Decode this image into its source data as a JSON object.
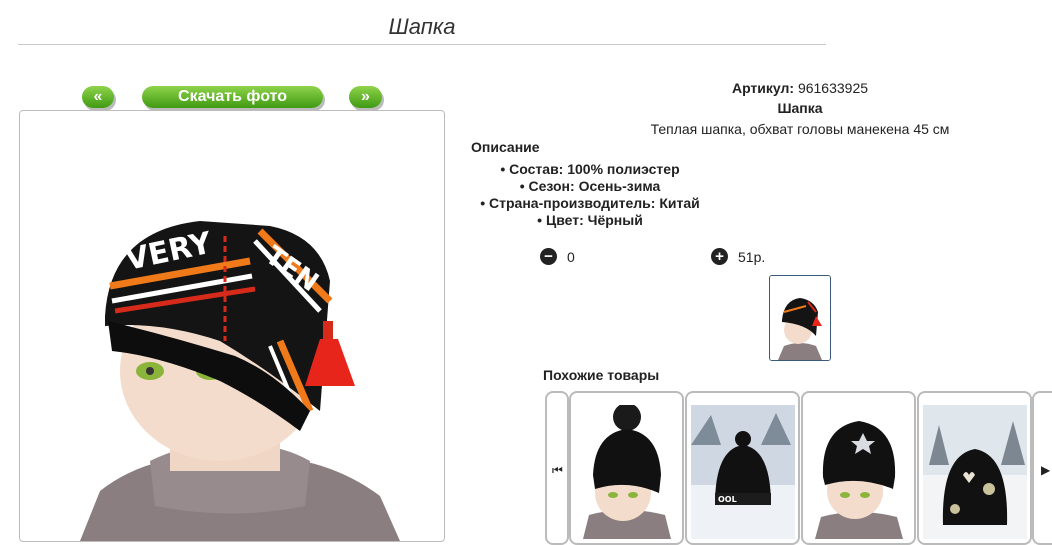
{
  "page": {
    "title": "Шапка"
  },
  "nav": {
    "prev_label": "«",
    "download_label": "Скачать фото",
    "next_label": "»"
  },
  "product": {
    "article_label": "Артикул:",
    "article_value": "961633925",
    "name": "Шапка",
    "short_description": "Теплая шапка, обхват головы манекена 45 см"
  },
  "description": {
    "heading": "Описание",
    "items": [
      "Состав: 100% полиэстер",
      "Сезон: Осень-зима",
      "Страна-производитель: Китай",
      "Цвет: Чёрный"
    ]
  },
  "quantity": {
    "value": "0",
    "price": "51р."
  },
  "similar": {
    "heading": "Похожие товары",
    "items": [
      {
        "name": "black-pompom-hat"
      },
      {
        "name": "black-hat-snow"
      },
      {
        "name": "black-hat-star"
      },
      {
        "name": "black-hat-hearts"
      }
    ]
  },
  "colors": {
    "accent_green": "#5cb82a",
    "hat_black": "#111111",
    "stripe_orange": "#f07a1a",
    "stripe_red": "#d62a1a"
  }
}
